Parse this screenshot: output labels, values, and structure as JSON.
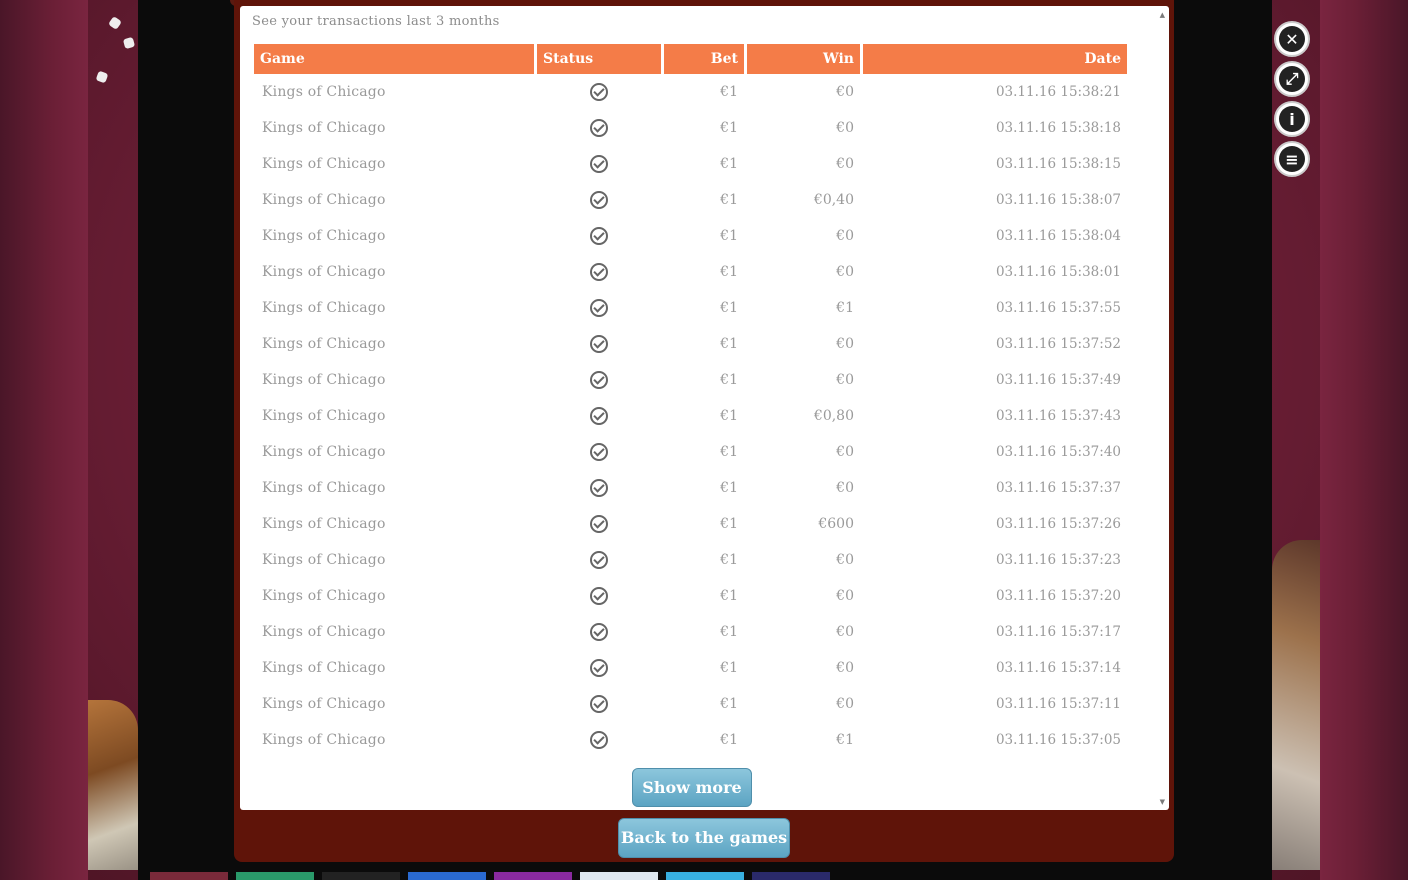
{
  "header": {
    "subtitle": "See your transactions last 3 months"
  },
  "table": {
    "columns": [
      "Game",
      "Status",
      "Bet",
      "Win",
      "Date"
    ],
    "rows": [
      {
        "game": "Kings of Chicago",
        "bet": "€1",
        "win": "€0",
        "date": "03.11.16 15:38:21"
      },
      {
        "game": "Kings of Chicago",
        "bet": "€1",
        "win": "€0",
        "date": "03.11.16 15:38:18"
      },
      {
        "game": "Kings of Chicago",
        "bet": "€1",
        "win": "€0",
        "date": "03.11.16 15:38:15"
      },
      {
        "game": "Kings of Chicago",
        "bet": "€1",
        "win": "€0,40",
        "date": "03.11.16 15:38:07"
      },
      {
        "game": "Kings of Chicago",
        "bet": "€1",
        "win": "€0",
        "date": "03.11.16 15:38:04"
      },
      {
        "game": "Kings of Chicago",
        "bet": "€1",
        "win": "€0",
        "date": "03.11.16 15:38:01"
      },
      {
        "game": "Kings of Chicago",
        "bet": "€1",
        "win": "€1",
        "date": "03.11.16 15:37:55"
      },
      {
        "game": "Kings of Chicago",
        "bet": "€1",
        "win": "€0",
        "date": "03.11.16 15:37:52"
      },
      {
        "game": "Kings of Chicago",
        "bet": "€1",
        "win": "€0",
        "date": "03.11.16 15:37:49"
      },
      {
        "game": "Kings of Chicago",
        "bet": "€1",
        "win": "€0,80",
        "date": "03.11.16 15:37:43"
      },
      {
        "game": "Kings of Chicago",
        "bet": "€1",
        "win": "€0",
        "date": "03.11.16 15:37:40"
      },
      {
        "game": "Kings of Chicago",
        "bet": "€1",
        "win": "€0",
        "date": "03.11.16 15:37:37"
      },
      {
        "game": "Kings of Chicago",
        "bet": "€1",
        "win": "€600",
        "date": "03.11.16 15:37:26"
      },
      {
        "game": "Kings of Chicago",
        "bet": "€1",
        "win": "€0",
        "date": "03.11.16 15:37:23"
      },
      {
        "game": "Kings of Chicago",
        "bet": "€1",
        "win": "€0",
        "date": "03.11.16 15:37:20"
      },
      {
        "game": "Kings of Chicago",
        "bet": "€1",
        "win": "€0",
        "date": "03.11.16 15:37:17"
      },
      {
        "game": "Kings of Chicago",
        "bet": "€1",
        "win": "€0",
        "date": "03.11.16 15:37:14"
      },
      {
        "game": "Kings of Chicago",
        "bet": "€1",
        "win": "€0",
        "date": "03.11.16 15:37:11"
      },
      {
        "game": "Kings of Chicago",
        "bet": "€1",
        "win": "€1",
        "date": "03.11.16 15:37:05"
      }
    ]
  },
  "buttons": {
    "show_more": "Show more",
    "back": "Back to the games"
  },
  "tools": [
    {
      "icon": "close-icon"
    },
    {
      "icon": "fullscreen-icon"
    },
    {
      "icon": "info-icon"
    },
    {
      "icon": "coins-icon"
    }
  ],
  "colors": {
    "header_bg": "#f47c48",
    "button_bg": "#6aaecb",
    "dialog_frame": "#5f1409"
  }
}
